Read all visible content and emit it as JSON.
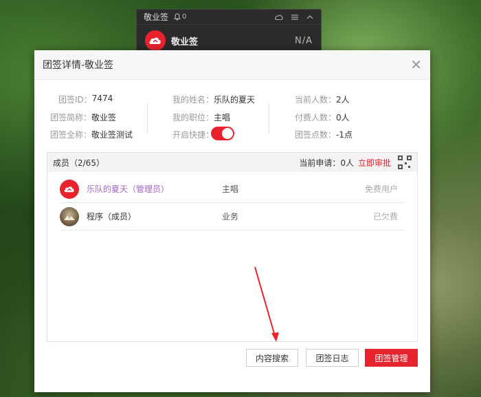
{
  "mini_window": {
    "title": "敬业签",
    "notify_count": "0",
    "note_name": "敬业签",
    "note_status": "N/A"
  },
  "dialog": {
    "title": "团签详情-敬业签",
    "info": {
      "id_label": "团签ID：",
      "id_value": "7474",
      "short_label": "团签简称：",
      "short_value": "敬业签",
      "full_label": "团签全称：",
      "full_value": "敬业签测试",
      "myname_label": "我的姓名：",
      "myname_value": "乐队的夏天",
      "mypos_label": "我的职位：",
      "mypos_value": "主唱",
      "shortcut_label": "开启快捷：",
      "shortcut_on": true,
      "cur_label": "当前人数：",
      "cur_value": "2人",
      "paid_label": "付费人数：",
      "paid_value": "0人",
      "points_label": "团签点数：",
      "points_value": "-1点"
    },
    "members": {
      "header": "成员（2/65）",
      "apply_label": "当前申请：",
      "apply_value": "0人",
      "approve_label": "立即审批",
      "rows": [
        {
          "name": "乐队的夏天（管理员）",
          "role": "主唱",
          "status": "免费用户"
        },
        {
          "name": "程序（成员）",
          "role": "业务",
          "status": "已欠费"
        }
      ]
    },
    "buttons": {
      "search": "内容搜索",
      "log": "团签日志",
      "manage": "团签管理"
    }
  },
  "colors": {
    "brand_red": "#e8232e",
    "admin_purple": "#a366c9",
    "annotation_arrow": "#e8232e"
  },
  "icons": [
    "bell-icon",
    "cloud-icon",
    "menu-icon",
    "collapse-icon",
    "close-icon",
    "qr-code-icon",
    "cloud-logo-icon"
  ]
}
